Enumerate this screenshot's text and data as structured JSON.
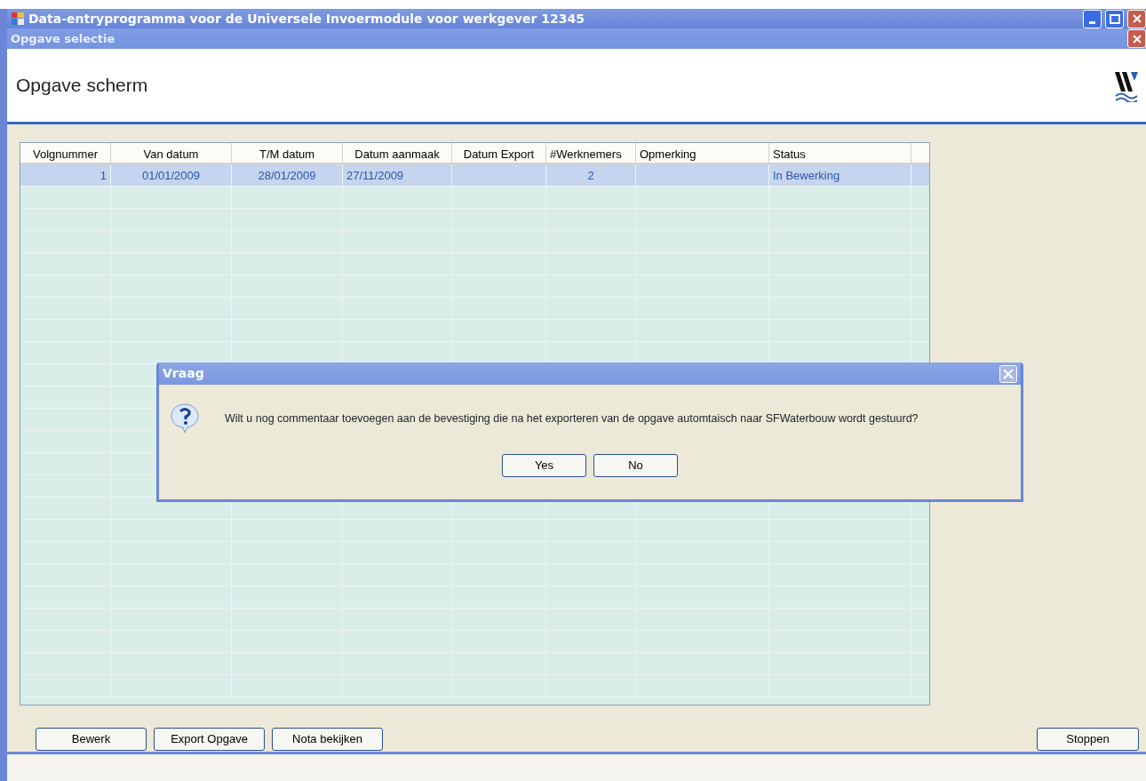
{
  "window": {
    "title": "Data-entryprogramma voor de Universele Invoermodule voor werkgever 12345"
  },
  "subwindow": {
    "title": "Opgave selectie"
  },
  "header": {
    "title": "Opgave scherm"
  },
  "table": {
    "columns": [
      "Volgnummer",
      "Van datum",
      "T/M datum",
      "Datum aanmaak",
      "Datum Export",
      "#Werknemers",
      "Opmerking",
      "Status"
    ],
    "rows": [
      {
        "cells": [
          "1",
          "01/01/2009",
          "28/01/2009",
          "27/11/2009",
          "",
          "2",
          "",
          "In Bewerking"
        ],
        "selected": true
      }
    ]
  },
  "dialog": {
    "title": "Vraag",
    "message": "Wilt u nog commentaar toevoegen aan de bevestiging die na het exporteren van de opgave automtaisch naar SFWaterbouw wordt gestuurd?",
    "buttons": [
      "Yes",
      "No"
    ]
  },
  "buttons": [
    "Bewerk",
    "Export Opgave",
    "Nota bekijken"
  ],
  "exit_button": "Stoppen"
}
